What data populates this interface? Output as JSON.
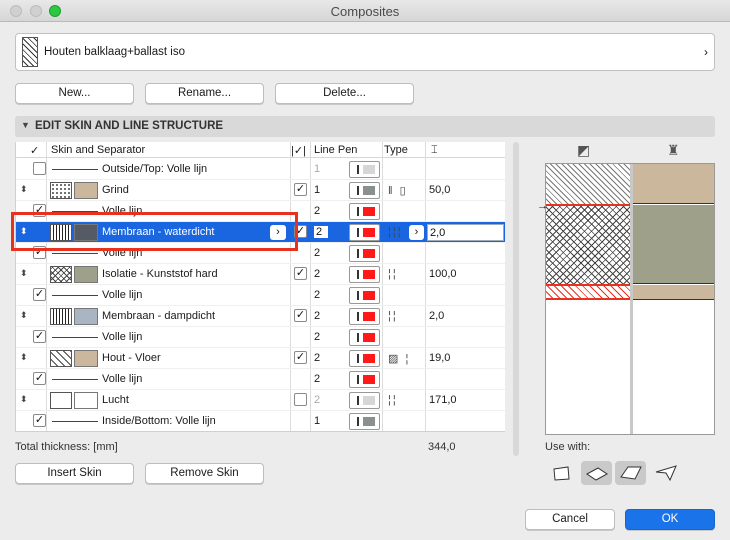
{
  "window": {
    "title": "Composites"
  },
  "selector": {
    "name": "Houten balklaag+ballast iso"
  },
  "buttons": {
    "new": "New...",
    "rename": "Rename...",
    "delete": "Delete...",
    "insert_skin": "Insert Skin",
    "remove_skin": "Remove Skin",
    "cancel": "Cancel",
    "ok": "OK"
  },
  "section": {
    "title": "EDIT SKIN AND LINE STRUCTURE"
  },
  "columns": {
    "check": "✓",
    "skin": "Skin and Separator",
    "line_pen": "Line Pen",
    "type": "Type"
  },
  "rows": [
    {
      "kind": "sep",
      "checked": false,
      "label": "Outside/Top: Volle lijn",
      "pen": "1",
      "pen_color": "#d6d6d6",
      "pen_disabled": true
    },
    {
      "kind": "skin",
      "label": "Grind",
      "hatch": "gravel",
      "color": "#cbb89c",
      "bar": true,
      "pen": "1",
      "pen_color": "#8a9090",
      "type": "‖ ▯",
      "thickness": "50,0"
    },
    {
      "kind": "sep",
      "checked": true,
      "label": "Volle lijn",
      "pen": "2",
      "pen_color": "#ff1a1a"
    },
    {
      "kind": "skin",
      "label": "Membraan - waterdicht",
      "hatch": "vlines",
      "color": "#555a64",
      "bar": true,
      "pen": "2",
      "pen_color": "#ff1a1a",
      "type": "¦¦¦",
      "thickness": "2,0",
      "selected": true
    },
    {
      "kind": "sep",
      "checked": true,
      "label": "Volle lijn",
      "pen": "2",
      "pen_color": "#ff1a1a"
    },
    {
      "kind": "skin",
      "label": "Isolatie - Kunststof hard",
      "hatch": "cross",
      "color": "#9fa08a",
      "bar": true,
      "pen": "2",
      "pen_color": "#ff1a1a",
      "type": "¦¦",
      "thickness": "100,0"
    },
    {
      "kind": "sep",
      "checked": true,
      "label": "Volle lijn",
      "pen": "2",
      "pen_color": "#ff1a1a"
    },
    {
      "kind": "skin",
      "label": "Membraan - dampdicht",
      "hatch": "vlines",
      "color": "#a9b5c2",
      "bar": true,
      "pen": "2",
      "pen_color": "#ff1a1a",
      "type": "¦¦",
      "thickness": "2,0"
    },
    {
      "kind": "sep",
      "checked": true,
      "label": "Volle lijn",
      "pen": "2",
      "pen_color": "#ff1a1a"
    },
    {
      "kind": "skin",
      "label": "Hout - Vloer",
      "hatch": "diag",
      "color": "#cbb89c",
      "bar": true,
      "pen": "2",
      "pen_color": "#ff1a1a",
      "type": "▨ ¦",
      "thickness": "19,0"
    },
    {
      "kind": "sep",
      "checked": true,
      "label": "Volle lijn",
      "pen": "2",
      "pen_color": "#ff1a1a"
    },
    {
      "kind": "skin",
      "label": "Lucht",
      "hatch": "empty",
      "color": "#ffffff",
      "bar": false,
      "pen": "2",
      "pen_color": "#d6d6d6",
      "pen_disabled": true,
      "type": "¦¦",
      "thickness": "171,0"
    },
    {
      "kind": "sep",
      "checked": true,
      "label": "Inside/Bottom: Volle lijn",
      "pen": "1",
      "pen_color": "#8a9090"
    }
  ],
  "total": {
    "label": "Total thickness: [mm]",
    "value": "344,0"
  },
  "use_with": {
    "label": "Use with:",
    "items": [
      "wall-icon",
      "slab-icon",
      "roof-icon",
      "shell-icon"
    ]
  },
  "colors": {
    "accent": "#1a66e0",
    "highlight": "#e8321f"
  }
}
